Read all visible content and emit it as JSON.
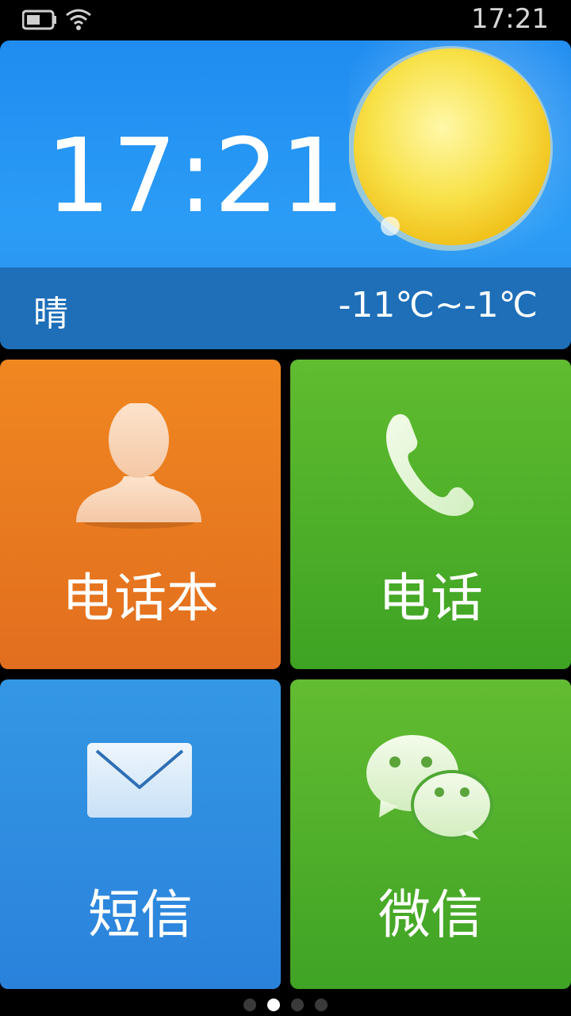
{
  "status_bar": {
    "time": "17:21"
  },
  "weather": {
    "time": "17:21",
    "condition": "晴",
    "temperature_range": "-11℃~-1℃"
  },
  "tiles": [
    {
      "label": "电话本",
      "icon": "contact-icon",
      "color": "#f08720"
    },
    {
      "label": "电话",
      "icon": "phone-icon",
      "color": "#60bc30"
    },
    {
      "label": "短信",
      "icon": "envelope-icon",
      "color": "#3497e4"
    },
    {
      "label": "微信",
      "icon": "wechat-icon",
      "color": "#63bc31"
    }
  ],
  "pager": {
    "count": 4,
    "active_index": 1
  }
}
